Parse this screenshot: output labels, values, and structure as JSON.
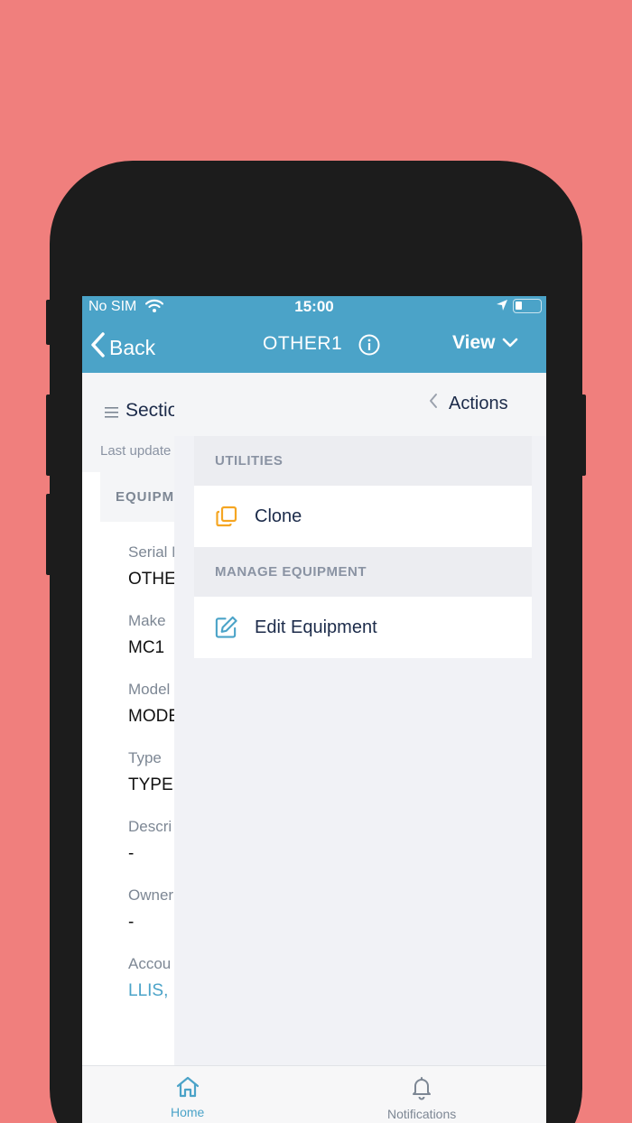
{
  "status_bar": {
    "carrier": "No SIM",
    "time": "15:00"
  },
  "nav": {
    "back_label": "Back",
    "title": "OTHER1",
    "view_label": "View"
  },
  "background": {
    "sections_label": "Sectio",
    "last_updated": "Last update",
    "equipment_header": "EQUIPM",
    "fields": [
      {
        "label": "Serial N",
        "value": "OTHE"
      },
      {
        "label": "Make",
        "value": "MC1"
      },
      {
        "label": "Model",
        "value": "MODE"
      },
      {
        "label": "Type",
        "value": "TYPE"
      },
      {
        "label": "Descri",
        "value": "-"
      },
      {
        "label": "Owner",
        "value": "-"
      },
      {
        "label": "Accou",
        "value": "LLIS, I"
      }
    ]
  },
  "actions_panel": {
    "back_label": "Actions",
    "sections": [
      {
        "title": "UTILITIES",
        "items": [
          {
            "label": "Clone",
            "icon": "clone-icon",
            "color": "#F5A623"
          }
        ]
      },
      {
        "title": "MANAGE EQUIPMENT",
        "items": [
          {
            "label": "Edit Equipment",
            "icon": "edit-icon",
            "color": "#4BA3C8"
          }
        ]
      }
    ]
  },
  "tab_bar": {
    "home_label": "Home",
    "notifications_label": "Notifications"
  },
  "colors": {
    "accent": "#4BA3C8",
    "background": "#F07F7D",
    "phone": "#1C1C1C",
    "clone_icon": "#F5A623"
  }
}
